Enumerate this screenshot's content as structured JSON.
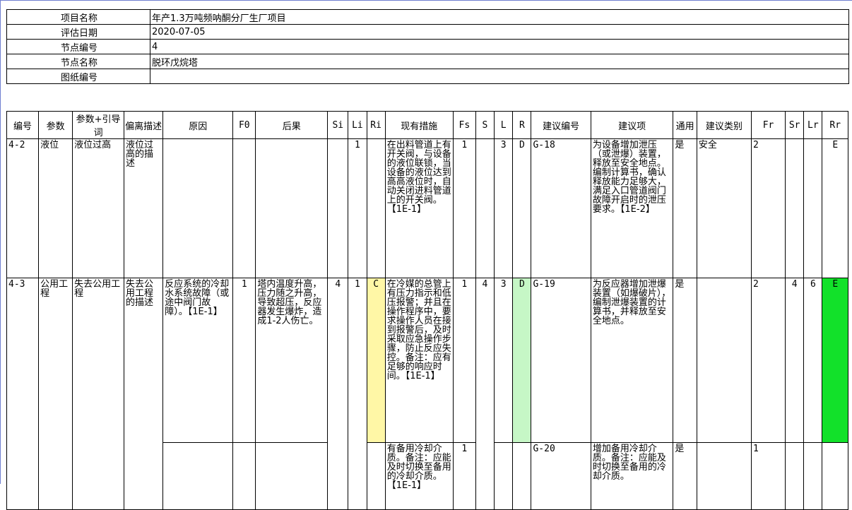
{
  "info": {
    "rows": [
      {
        "label": "项目名称",
        "value": "年产1.3万吨频呐酮分厂生厂项目"
      },
      {
        "label": "评估日期",
        "value": "2020-07-05"
      },
      {
        "label": "节点编号",
        "value": "4"
      },
      {
        "label": "节点名称",
        "value": "脱环戊烷塔"
      },
      {
        "label": "图纸编号",
        "value": ""
      }
    ]
  },
  "grid": {
    "headers": [
      "编号",
      "参数",
      "参数+引导词",
      "偏离描述",
      "原因",
      "F0",
      "后果",
      "Si",
      "Li",
      "Ri",
      "现有措施",
      "Fs",
      "S",
      "L",
      "R",
      "建议编号",
      "建议项",
      "通用",
      "建议类别",
      "Fr",
      "Sr",
      "Lr",
      "Rr"
    ],
    "row1": {
      "id": "4-2",
      "param": "液位",
      "guide": "液位过高",
      "deviation": "液位过高的描述",
      "cause": "",
      "f0": "",
      "consequence": "",
      "si": "",
      "li": "1",
      "ri": "",
      "measure": "在出料管道上有开关阀，与设备的液位联锁，当设备的液位达到高高液位时，自动关闭进料管道上的开关阀。【1E-1】",
      "fs": "1",
      "s": "",
      "l": "3",
      "r": "D",
      "sug_no": "G-18",
      "suggestion": "为设备增加泄压（或泄爆）装置，释放至安全地点。编制计算书，确认释放能力足够大，满足入口管道阀门故障开启时的泄压要求。【1E-2】",
      "general": "是",
      "category": "安全",
      "fr": "2",
      "sr": "",
      "lr": "",
      "rr": "E"
    },
    "row2": {
      "id": "4-3",
      "param": "公用工程",
      "guide": "失去公用工程",
      "deviation": "失去公用工程的描述",
      "cause": "反应系统的冷却水系统故障（或途中阀门故障）。【1E-1】",
      "f0": "1",
      "consequence": "塔内温度升高，压力随之升高，导致超压，反应器发生爆炸，造成1-2人伤亡。",
      "si": "4",
      "li": "1",
      "ri": "C",
      "measure": "在冷媒的总管上有压力指示和低压报警；并且在操作程序中，要求操作人员在接到报警后，及时采取应急操作步骤，防止反应失控。备注：应有足够的响应时间。【1E-1】",
      "fs": "1",
      "s": "4",
      "l": "3",
      "r": "D",
      "sug_no": "G-19",
      "suggestion": "为反应器增加泄爆装置（如爆破片），编制泄爆装置的计算书，并释放至安全地点。",
      "general": "是",
      "category": "",
      "fr": "2",
      "sr": "4",
      "lr": "6",
      "rr": "E"
    },
    "row3": {
      "measure": "有备用冷却介质。备注：应能及时切换至备用的冷却介质。【1E-1】",
      "fs": "1",
      "sug_no": "G-20",
      "suggestion": "增加备用冷却介质。备注：应能及时切换至备用的冷却介质。",
      "general": "是",
      "fr": "1"
    }
  },
  "colors": {
    "ri_highlight": "#fff7a6",
    "r_highlight": "#c6f7c6",
    "rr_highlight": "#12e12a",
    "frame": "#6f7fd0"
  }
}
